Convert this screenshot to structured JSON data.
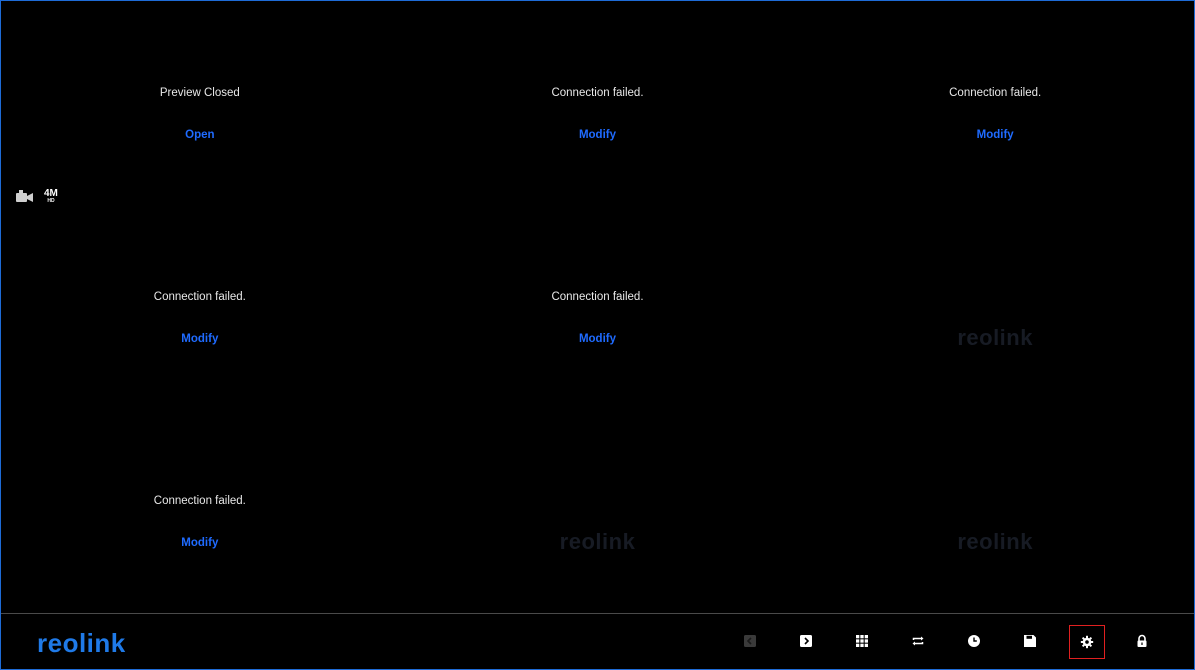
{
  "cells": [
    {
      "status": "Preview Closed",
      "action": "Open"
    },
    {
      "status": "Connection failed.",
      "action": "Modify"
    },
    {
      "status": "Connection failed.",
      "action": "Modify"
    },
    {
      "status": "Connection failed.",
      "action": "Modify"
    },
    {
      "status": "Connection failed.",
      "action": "Modify"
    },
    {
      "watermark": "reolink"
    },
    {
      "status": "Connection failed.",
      "action": "Modify"
    },
    {
      "watermark": "reolink"
    },
    {
      "watermark": "reolink"
    }
  ],
  "overlay": {
    "camera_icon": "video-camera-icon",
    "resolution": "4M",
    "resolution_sub": "HD"
  },
  "toolbar": {
    "logo": "reolink",
    "buttons": [
      {
        "icon": "previous-icon",
        "disabled": true
      },
      {
        "icon": "next-icon"
      },
      {
        "icon": "grid-layout-icon"
      },
      {
        "icon": "cycle-icon"
      },
      {
        "icon": "playback-clock-icon"
      },
      {
        "icon": "save-icon"
      },
      {
        "icon": "settings-gear-icon",
        "selected": true
      },
      {
        "icon": "lock-icon"
      }
    ]
  },
  "colors": {
    "accent": "#1f6bff",
    "logo": "#1f7ae8",
    "border": "#1e6bd6",
    "selected_outline": "#e02020"
  }
}
